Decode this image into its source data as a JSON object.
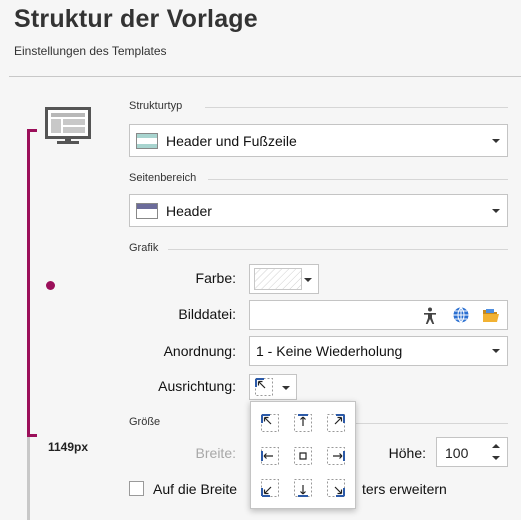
{
  "page": {
    "title": "Struktur der Vorlage",
    "subtitle": "Einstellungen des Templates"
  },
  "preview": {
    "height_label": "1149px",
    "icon": "monitor-layout-icon",
    "accent_color": "#9b0f5a"
  },
  "strukturtyp": {
    "label": "Strukturtyp",
    "value": "Header und Fußzeile",
    "icon": "header-footer-layout-icon"
  },
  "seitenbereich": {
    "label": "Seitenbereich",
    "value": "Header",
    "icon": "header-layout-icon"
  },
  "grafik": {
    "label": "Grafik",
    "farbe_label": "Farbe:",
    "bilddatei_label": "Bilddatei:",
    "bilddatei_value": "",
    "bilddatei_icons": [
      "accessibility-icon",
      "globe-icon",
      "folder-open-icon"
    ],
    "anordnung_label": "Anordnung:",
    "anordnung_value": "1 - Keine Wiederholung",
    "ausrichtung_label": "Ausrichtung:",
    "ausrichtung_value": "top-left",
    "alignment_options": [
      "top-left",
      "top-center",
      "top-right",
      "middle-left",
      "center",
      "middle-right",
      "bottom-left",
      "bottom-center",
      "bottom-right"
    ]
  },
  "groesse": {
    "label": "Größe",
    "breite_label": "Breite:",
    "hoehe_label": "Höhe:",
    "hoehe_value": "100",
    "checkbox_label_start": "Auf die Breite",
    "checkbox_label_end": "ters erweitern",
    "checkbox_checked": false
  }
}
